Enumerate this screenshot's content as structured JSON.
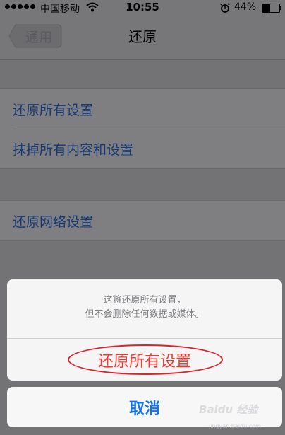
{
  "status_bar": {
    "carrier": "中国移动",
    "time": "10:55",
    "battery": "44%",
    "battery_level": 0.44,
    "signal_bars": 5
  },
  "nav": {
    "back_label": "通用",
    "title": "还原"
  },
  "list": {
    "group1": [
      "还原所有设置",
      "抹掉所有内容和设置"
    ],
    "group2": [
      "还原网络设置"
    ]
  },
  "action_sheet": {
    "message_line1": "这将还原所有设置，",
    "message_line2": "但不会删除任何数据或媒体。",
    "destructive_label": "还原所有设置",
    "cancel_label": "取消"
  },
  "watermark": {
    "text": "Baidu 经验",
    "sub": "jingyan.baidu.com"
  },
  "colors": {
    "link": "#173a74",
    "destructive": "#ee3b32",
    "cancel": "#1472e6",
    "annotation": "#e0202a"
  }
}
